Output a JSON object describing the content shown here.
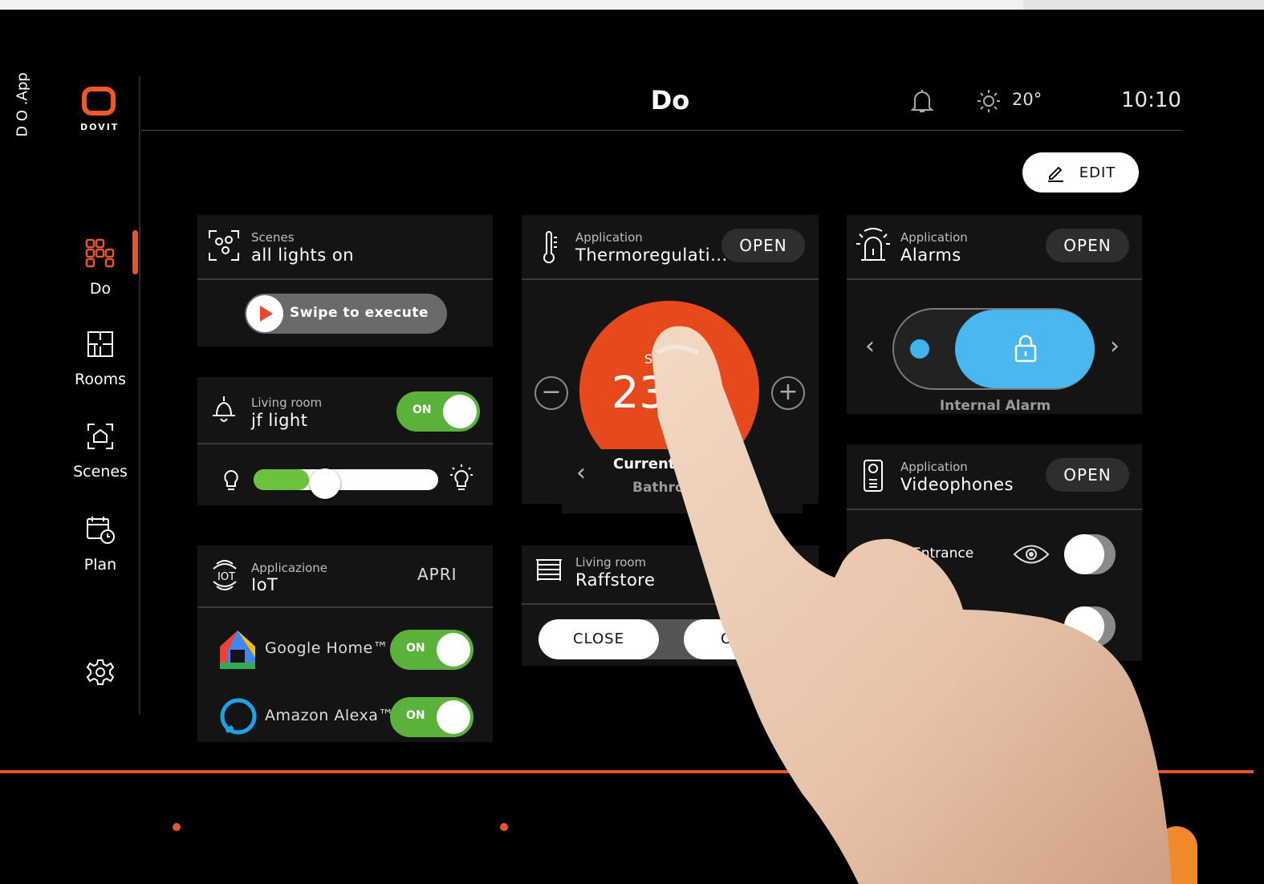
{
  "brand": {
    "app_tag": "D O .App",
    "logo_text": "DOVIT"
  },
  "header": {
    "title": "Do",
    "temperature": "20°",
    "time": "10:10",
    "edit_label": "EDIT"
  },
  "sidebar": {
    "items": [
      {
        "label": "Do",
        "icon": "grid-icon",
        "active": true
      },
      {
        "label": "Rooms",
        "icon": "floorplan-icon"
      },
      {
        "label": "Scenes",
        "icon": "scenes-icon"
      },
      {
        "label": "Plan",
        "icon": "calendar-clock-icon"
      }
    ],
    "settings_icon": "gear-icon"
  },
  "cards": {
    "scenes": {
      "caption": "Scenes",
      "name": "all lights on",
      "swipe_label": "Swipe to execute"
    },
    "light": {
      "caption": "Living room",
      "name": "jf light",
      "toggle": "ON",
      "brightness": 0.3
    },
    "iot": {
      "caption": "Applicazione",
      "name": "IoT",
      "action": "APRI",
      "services": [
        {
          "label": "Google Home™",
          "toggle": "ON"
        },
        {
          "label": "Amazon Alexa™",
          "toggle": "ON"
        }
      ]
    },
    "thermo": {
      "caption": "Application",
      "name": "Thermoregulati...",
      "action": "OPEN",
      "value": "23",
      "setpoint_prefix": "S",
      "currently": "Currently",
      "room": "Bathro"
    },
    "raffstore": {
      "caption": "Living room",
      "name": "Raffstore",
      "close": "CLOSE",
      "open": "OPE"
    },
    "alarms": {
      "caption": "Application",
      "name": "Alarms",
      "action": "OPEN",
      "alarm_label": "Internal Alarm"
    },
    "videophones": {
      "caption": "Application",
      "name": "Videophones",
      "action": "OPEN",
      "entrance": "Entrance"
    }
  },
  "colors": {
    "accent": "#e8552a",
    "toggle_on": "#5bb23a",
    "alarm": "#4ab7ee"
  }
}
